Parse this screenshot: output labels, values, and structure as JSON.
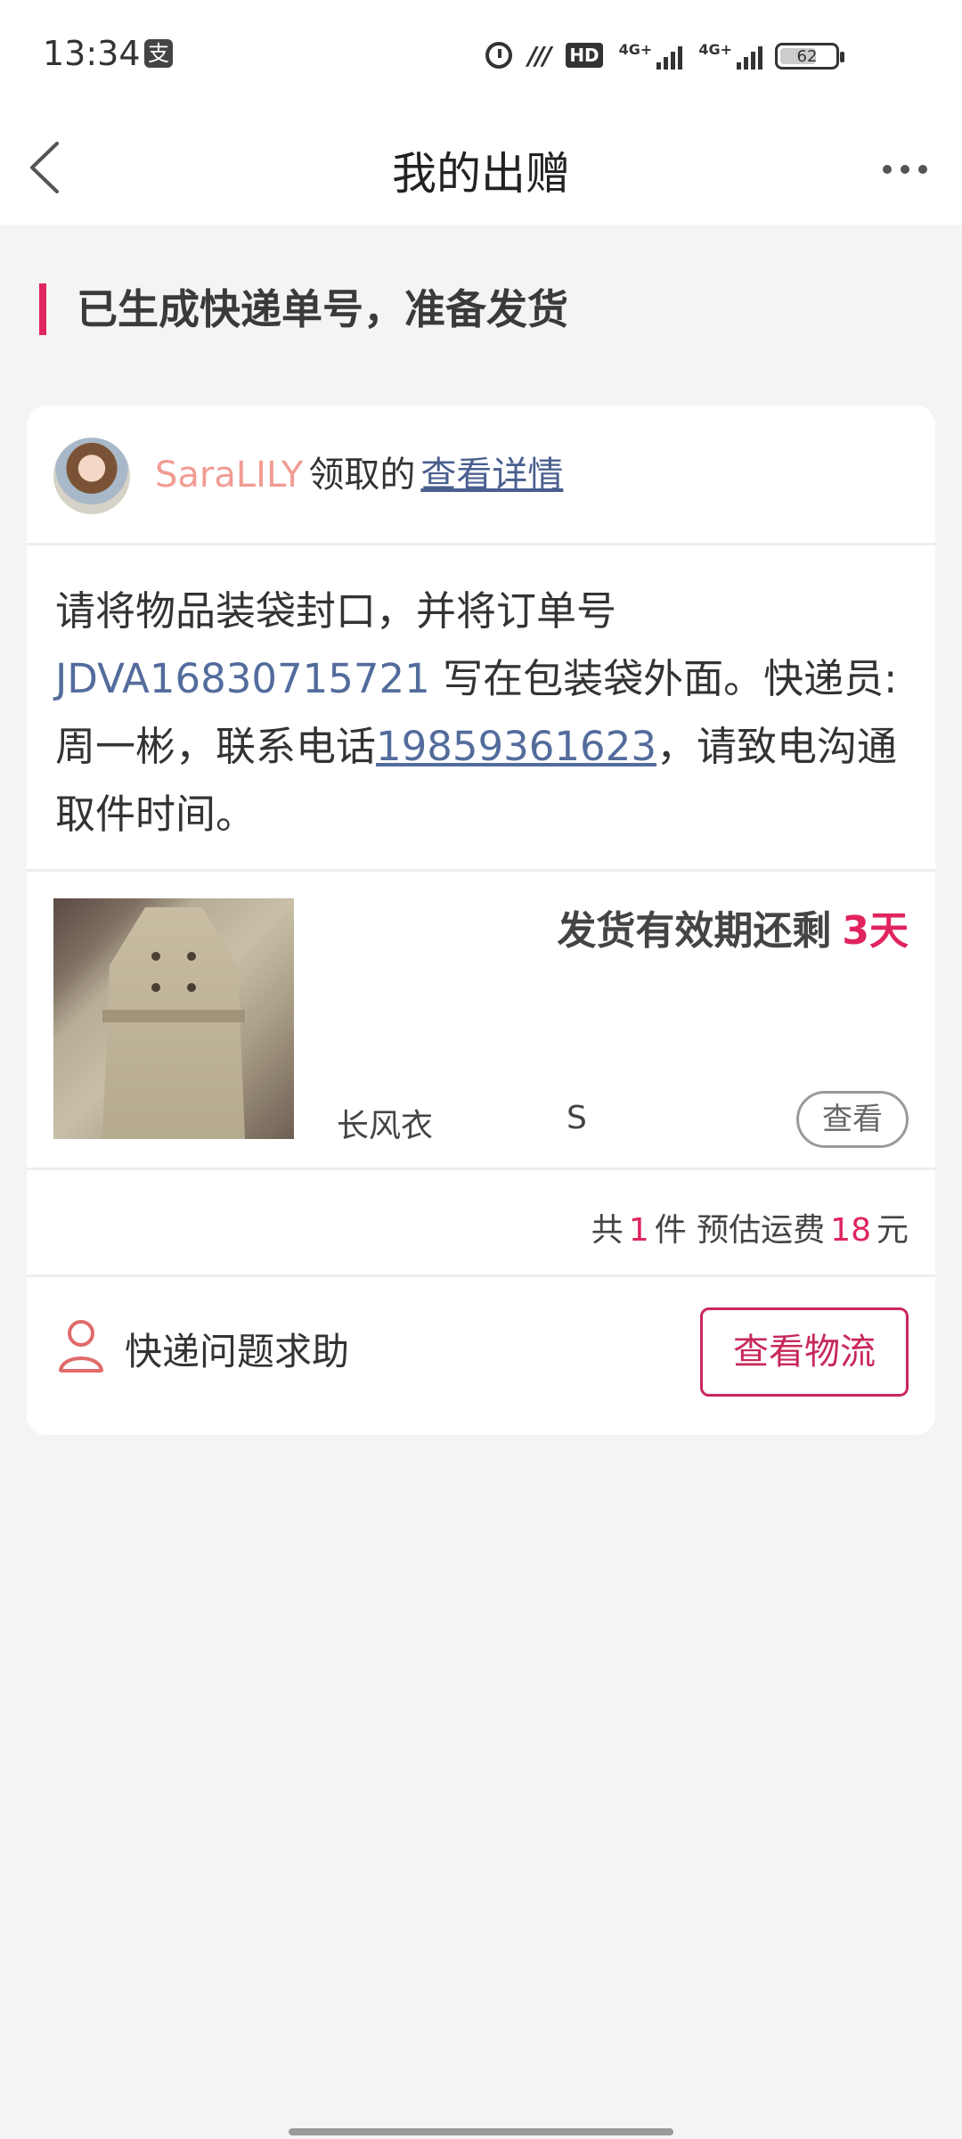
{
  "status_bar": {
    "time": "13:34",
    "pay_icon": "支",
    "hd_label": "HD",
    "network_a": "4G+",
    "network_b": "4G+",
    "battery": "62"
  },
  "nav": {
    "title": "我的出赠"
  },
  "status": {
    "title": "已生成快递单号，准备发货"
  },
  "receiver": {
    "username": "SaraLILY",
    "received_text": "领取的",
    "detail_link": "查看详情"
  },
  "instruction": {
    "part1": "请将物品装袋封口，并将订单号 ",
    "order_no": "JDVA16830715721",
    "part2": " 写在包装袋外面。快递员:周一彬，联系电话",
    "phone": "19859361623",
    "part3": "，请致电沟通取件时间。"
  },
  "item": {
    "deadline_text": "发货有效期还剩",
    "deadline_days": "3天",
    "name": "长风衣",
    "size": "S",
    "view_label": "查看"
  },
  "summary": {
    "prefix": "共",
    "count": "1",
    "count_unit": "件 预估运费",
    "fee": "18",
    "fee_unit": "元"
  },
  "help": {
    "label": "快递问题求助",
    "logistics_button": "查看物流"
  },
  "colors": {
    "accent": "#e0245e",
    "link": "#536c9c",
    "username": "#f19c93"
  }
}
